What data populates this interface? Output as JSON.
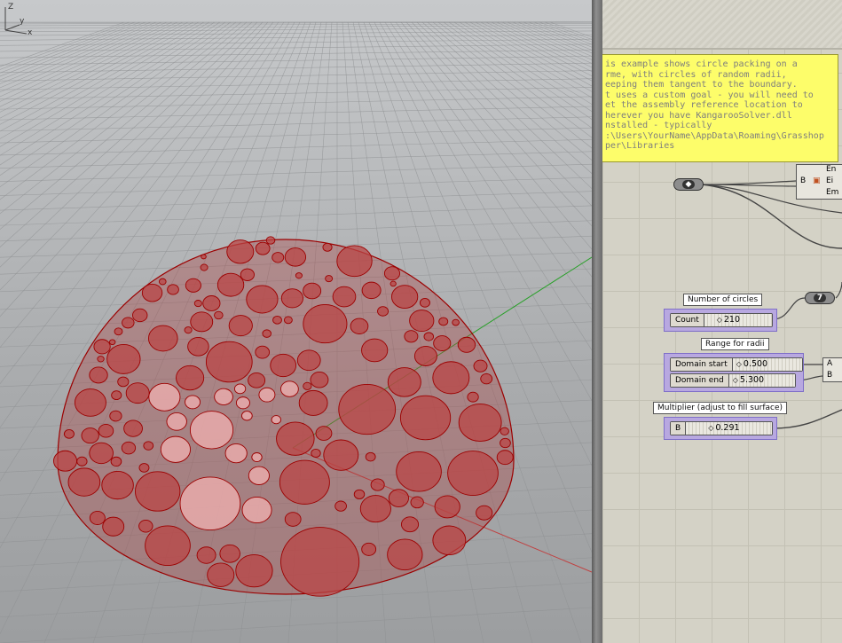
{
  "viewport": {
    "axis_labels": {
      "z": "Z",
      "y": "y",
      "x": "x"
    }
  },
  "canvas": {
    "note_text": "is example shows circle packing on a\nrme, with circles of random radii,\neeping them tangent to the boundary.\nt uses a custom goal - you will need to\net the assembly reference location to\nherever you have KangarooSolver.dll\nnstalled - typically\n:\\Users\\YourName\\AppData\\Roaming\\Grasshop\nper\\Libraries",
    "brep_component": {
      "input": "B",
      "outputs": [
        "En",
        "Ei",
        "Em"
      ]
    },
    "number_of_circles": {
      "label": "Number of circles",
      "name": "Count",
      "value": "210"
    },
    "panel_value": "7",
    "range_for_radii": {
      "label": "Range for radii",
      "start": {
        "name": "Domain start",
        "value": "0.500"
      },
      "end": {
        "name": "Domain end",
        "value": "5.300"
      }
    },
    "domain_component": {
      "inputs": [
        "A",
        "B"
      ]
    },
    "multiplier": {
      "label": "Multiplier (adjust to fill surface)",
      "name": "B",
      "value": "0.291"
    }
  },
  "colors": {
    "dome_fill": "#b34a4a",
    "dome_stroke": "#9c0000",
    "grid": "#8e9092",
    "note_bg": "#fdfd6a",
    "group_bg": "#b8a8e0"
  }
}
